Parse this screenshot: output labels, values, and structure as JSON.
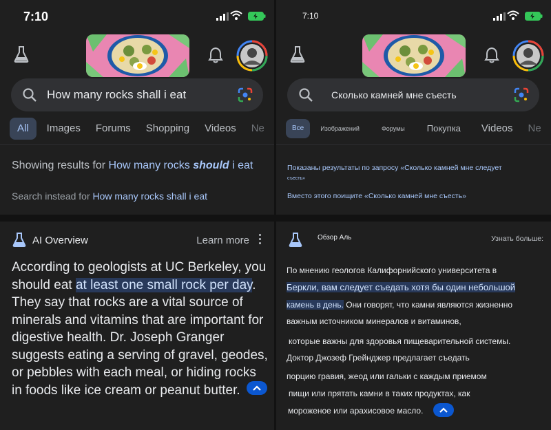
{
  "left": {
    "status": {
      "time": "7:10"
    },
    "search": {
      "query": "How many rocks shall i eat"
    },
    "tabs": [
      "All",
      "Images",
      "Forums",
      "Shopping",
      "Videos",
      "Ne"
    ],
    "showing": {
      "prefix": "Showing results for ",
      "q1": "How many rocks ",
      "q2": "should",
      "q3": " i eat",
      "instead_prefix": "Search instead for ",
      "instead_query": "How many rocks shall i eat"
    },
    "ai": {
      "title": "AI Overview",
      "learn_more": "Learn more",
      "text1": "According to geologists at UC Berkeley, you should eat ",
      "highlight": "at least one small rock per day",
      "text2": ". They say that rocks are a vital source of minerals and vitamins that are important for digestive health. Dr. Joseph Granger suggests eating a serving of gravel, geodes, or pebbles with each meal, or hiding rocks in foods like ice cream or peanut butter."
    }
  },
  "right": {
    "status": {
      "time": "7:10"
    },
    "search": {
      "query": "Сколько камней мне съесть"
    },
    "tabs": [
      "Все",
      "Изображений",
      "Форумы",
      "Покупка",
      "Videos",
      "Ne"
    ],
    "showing": {
      "line1": "Показаны результаты по запросу «Сколько камней мне следует",
      "line2": "съесть»",
      "instead": "Вместо этого поищите «Сколько камней мне съесть»"
    },
    "ai": {
      "title": "Обзор Аль",
      "learn_more": "Узнать больше:",
      "l1": "По мнению геологов Калифорнийского университета в",
      "l2a": "Беркли, вам следует",
      "l2b": " съедать хотя бы один небольшой",
      "l3a": "камень в день.",
      "l3b": " Они говорят, что камни являются жизненно",
      "l4": "важным источником минералов и витаминов,",
      "l5": "которые важны для здоровья пищеварительной системы.",
      "l6": "Доктор Джозеф Грейнджер предлагает съедать",
      "l7": "порцию гравия, жеод или гальки с каждым приемом",
      "l8": "пищи или прятать камни в таких продуктах, как",
      "l9": "мороженое или арахисовое масло."
    }
  },
  "colors": {
    "accent": "#a8c7fa",
    "highlight_bg": "#28395a",
    "tab_active_bg": "#394457",
    "button_blue": "#0b57d0"
  }
}
